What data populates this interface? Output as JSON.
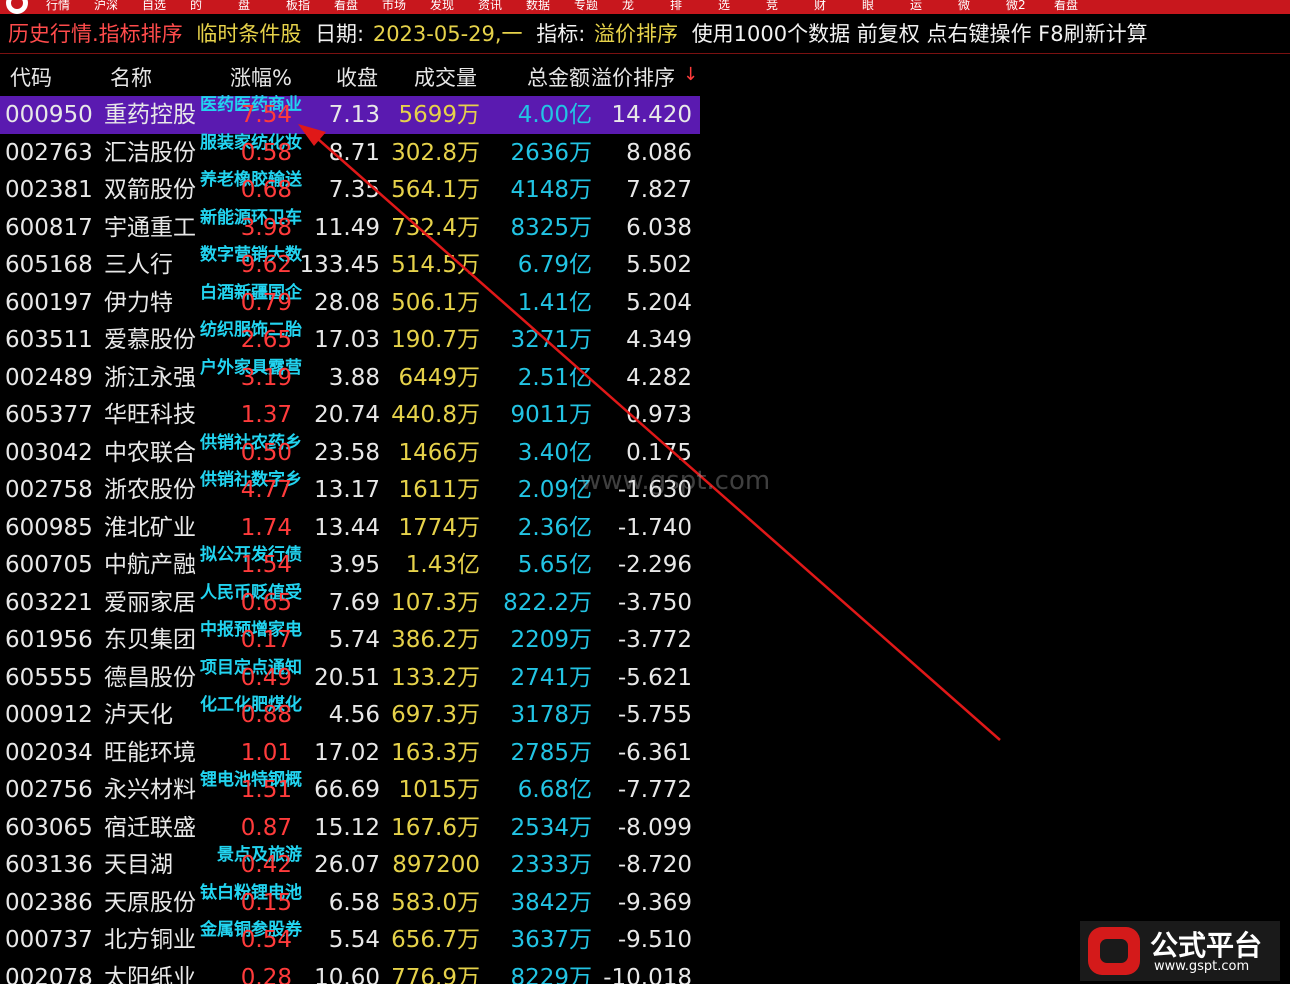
{
  "menubar": {
    "items": [
      "行情",
      "沪深",
      "自选",
      "的",
      "盘",
      "板指",
      "看盘",
      "市场",
      "发现",
      "资讯",
      "数据",
      "专题",
      "龙",
      "排",
      "选",
      "竞",
      "财",
      "眼",
      "运",
      "微",
      "微2",
      "看盘"
    ]
  },
  "infobar": {
    "title": "历史行情.指标排序",
    "cond": "临时条件股",
    "date_label": "日期:",
    "date_value": "2023-05-29,一",
    "indicator_label": "指标:",
    "indicator_value": "溢价排序",
    "note": "使用1000个数据 前复权 点右键操作 F8刷新计算"
  },
  "headers": {
    "code": "代码",
    "name": "名称",
    "chg": "涨幅%",
    "close": "收盘",
    "vol": "成交量",
    "amt": "总金额",
    "sort": "溢价排序",
    "sort_arrow": "↓"
  },
  "rows": [
    {
      "code": "000950",
      "name": "重药控股",
      "tag": "医药医药商业",
      "chg": "7.54",
      "close": "7.13",
      "vol": "5699万",
      "amt": "4.00亿",
      "sort": "14.420"
    },
    {
      "code": "002763",
      "name": "汇洁股份",
      "tag": "服装家纺化妆",
      "chg": "0.58",
      "close": "8.71",
      "vol": "302.8万",
      "amt": "2636万",
      "sort": "8.086"
    },
    {
      "code": "002381",
      "name": "双箭股份",
      "tag": "养老橡胶输送",
      "chg": "0.68",
      "close": "7.35",
      "vol": "564.1万",
      "amt": "4148万",
      "sort": "7.827"
    },
    {
      "code": "600817",
      "name": "宇通重工",
      "tag": "新能源环卫车",
      "chg": "3.98",
      "close": "11.49",
      "vol": "732.4万",
      "amt": "8325万",
      "sort": "6.038"
    },
    {
      "code": "605168",
      "name": "三人行",
      "tag": "数字营销大数",
      "chg": "9.62",
      "close": "133.45",
      "vol": "514.5万",
      "amt": "6.79亿",
      "sort": "5.502"
    },
    {
      "code": "600197",
      "name": "伊力特",
      "tag": "白酒新疆国企",
      "chg": "0.79",
      "close": "28.08",
      "vol": "506.1万",
      "amt": "1.41亿",
      "sort": "5.204"
    },
    {
      "code": "603511",
      "name": "爱慕股份",
      "tag": "纺织服饰二胎",
      "chg": "2.65",
      "close": "17.03",
      "vol": "190.7万",
      "amt": "3271万",
      "sort": "4.349"
    },
    {
      "code": "002489",
      "name": "浙江永强",
      "tag": "户外家具露营",
      "chg": "3.19",
      "close": "3.88",
      "vol": "6449万",
      "amt": "2.51亿",
      "sort": "4.282"
    },
    {
      "code": "605377",
      "name": "华旺科技",
      "tag": "",
      "chg": "1.37",
      "close": "20.74",
      "vol": "440.8万",
      "amt": "9011万",
      "sort": "0.973"
    },
    {
      "code": "003042",
      "name": "中农联合",
      "tag": "供销社农药乡",
      "chg": "0.50",
      "close": "23.58",
      "vol": "1466万",
      "amt": "3.40亿",
      "sort": "0.175"
    },
    {
      "code": "002758",
      "name": "浙农股份",
      "tag": "供销社数字乡",
      "chg": "4.77",
      "close": "13.17",
      "vol": "1611万",
      "amt": "2.09亿",
      "sort": "-1.630"
    },
    {
      "code": "600985",
      "name": "淮北矿业",
      "tag": "",
      "chg": "1.74",
      "close": "13.44",
      "vol": "1774万",
      "amt": "2.36亿",
      "sort": "-1.740"
    },
    {
      "code": "600705",
      "name": "中航产融",
      "tag": "拟公开发行债",
      "chg": "1.54",
      "close": "3.95",
      "vol": "1.43亿",
      "amt": "5.65亿",
      "sort": "-2.296"
    },
    {
      "code": "603221",
      "name": "爱丽家居",
      "tag": "人民币贬值受",
      "chg": "0.65",
      "close": "7.69",
      "vol": "107.3万",
      "amt": "822.2万",
      "sort": "-3.750"
    },
    {
      "code": "601956",
      "name": "东贝集团",
      "tag": "中报预增家电",
      "chg": "0.17",
      "close": "5.74",
      "vol": "386.2万",
      "amt": "2209万",
      "sort": "-3.772"
    },
    {
      "code": "605555",
      "name": "德昌股份",
      "tag": "项目定点通知",
      "chg": "0.49",
      "close": "20.51",
      "vol": "133.2万",
      "amt": "2741万",
      "sort": "-5.621"
    },
    {
      "code": "000912",
      "name": "泸天化",
      "tag": "化工化肥煤化",
      "chg": "0.88",
      "close": "4.56",
      "vol": "697.3万",
      "amt": "3178万",
      "sort": "-5.755"
    },
    {
      "code": "002034",
      "name": "旺能环境",
      "tag": "",
      "chg": "1.01",
      "close": "17.02",
      "vol": "163.3万",
      "amt": "2785万",
      "sort": "-6.361"
    },
    {
      "code": "002756",
      "name": "永兴材料",
      "tag": "锂电池特钢概",
      "chg": "1.51",
      "close": "66.69",
      "vol": "1015万",
      "amt": "6.68亿",
      "sort": "-7.772"
    },
    {
      "code": "603065",
      "name": "宿迁联盛",
      "tag": "",
      "chg": "0.87",
      "close": "15.12",
      "vol": "167.6万",
      "amt": "2534万",
      "sort": "-8.099"
    },
    {
      "code": "603136",
      "name": "天目湖",
      "tag": "景点及旅游",
      "chg": "0.42",
      "close": "26.07",
      "vol": "897200",
      "amt": "2333万",
      "sort": "-8.720"
    },
    {
      "code": "002386",
      "name": "天原股份",
      "tag": "钛白粉锂电池",
      "chg": "0.15",
      "close": "6.58",
      "vol": "583.0万",
      "amt": "3842万",
      "sort": "-9.369"
    },
    {
      "code": "000737",
      "name": "北方铜业",
      "tag": "金属铜参股券",
      "chg": "0.54",
      "close": "5.54",
      "vol": "656.7万",
      "amt": "3637万",
      "sort": "-9.510"
    },
    {
      "code": "002078",
      "name": "太阳纸业",
      "tag": "",
      "chg": "0.28",
      "close": "10.60",
      "vol": "776.9万",
      "amt": "8229万",
      "sort": "-10.018"
    }
  ],
  "watermark": "www.gspt.com",
  "logo": {
    "name": "公式平台",
    "url": "www.gspt.com"
  },
  "colors": {
    "selected_row": "#5a1ab0",
    "up": "#ff3b3b",
    "volume": "#e6d24a",
    "amount": "#22c4e4",
    "tag": "#22d4f0",
    "arrow": "#e01818"
  }
}
